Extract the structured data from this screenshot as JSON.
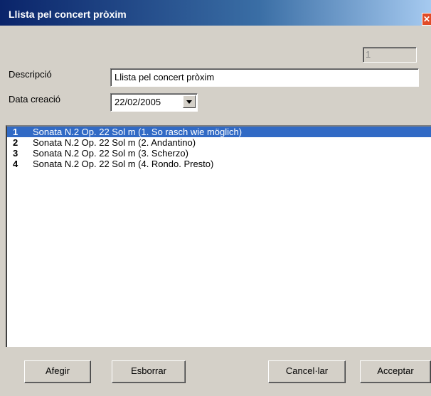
{
  "window": {
    "title": "Llista pel concert pròxim",
    "close_glyph": "✕"
  },
  "form": {
    "id_value": "1",
    "description_label": "Descripció",
    "description_value": "Llista pel concert pròxim",
    "date_label": "Data creació",
    "date_value": "22/02/2005"
  },
  "list": {
    "items": [
      {
        "num": "1",
        "text": "Sonata N.2 Op. 22  Sol m (1. So rasch wie möglich)",
        "selected": true
      },
      {
        "num": "2",
        "text": "Sonata N.2 Op. 22  Sol m (2. Andantino)",
        "selected": false
      },
      {
        "num": "3",
        "text": "Sonata N.2 Op. 22  Sol m (3. Scherzo)",
        "selected": false
      },
      {
        "num": "4",
        "text": "Sonata N.2 Op. 22  Sol m (4. Rondo. Presto)",
        "selected": false
      }
    ]
  },
  "buttons": {
    "add": "Afegir",
    "delete": "Esborrar",
    "cancel": "Cancel·lar",
    "accept": "Acceptar"
  },
  "colors": {
    "title_bar_start": "#0a246a",
    "selection": "#316ac5",
    "dialog_face": "#d4d0c8"
  }
}
